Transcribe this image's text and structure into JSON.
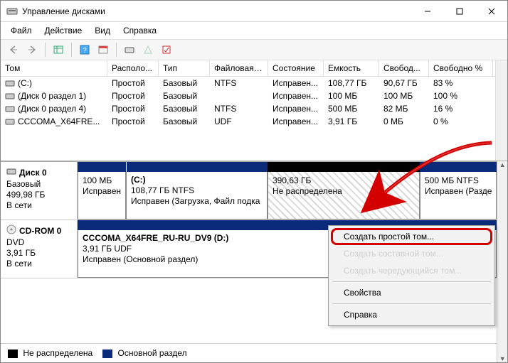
{
  "window": {
    "title": "Управление дисками"
  },
  "menu": {
    "file": "Файл",
    "action": "Действие",
    "view": "Вид",
    "help": "Справка"
  },
  "columns": {
    "volume": "Том",
    "layout": "Располо...",
    "type": "Тип",
    "fs": "Файловая с...",
    "status": "Состояние",
    "capacity": "Емкость",
    "free": "Свобод...",
    "free_pct": "Свободно %"
  },
  "volumes": [
    {
      "name": "(C:)",
      "layout": "Простой",
      "type": "Базовый",
      "fs": "NTFS",
      "status": "Исправен...",
      "capacity": "108,77 ГБ",
      "free": "90,67 ГБ",
      "free_pct": "83 %"
    },
    {
      "name": "(Диск 0 раздел 1)",
      "layout": "Простой",
      "type": "Базовый",
      "fs": "",
      "status": "Исправен...",
      "capacity": "100 МБ",
      "free": "100 МБ",
      "free_pct": "100 %"
    },
    {
      "name": "(Диск 0 раздел 4)",
      "layout": "Простой",
      "type": "Базовый",
      "fs": "NTFS",
      "status": "Исправен...",
      "capacity": "500 МБ",
      "free": "82 МБ",
      "free_pct": "16 %"
    },
    {
      "name": "CCCOMA_X64FRE...",
      "layout": "Простой",
      "type": "Базовый",
      "fs": "UDF",
      "status": "Исправен...",
      "capacity": "3,91 ГБ",
      "free": "0 МБ",
      "free_pct": "0 %"
    }
  ],
  "disk0": {
    "title": "Диск 0",
    "type": "Базовый",
    "size": "499,98 ГБ",
    "state": "В сети",
    "part0": {
      "title": "",
      "size": "100 МБ",
      "status": "Исправен"
    },
    "part1": {
      "title": "(C:)",
      "size": "108,77 ГБ NTFS",
      "status": "Исправен (Загрузка, Файл подка"
    },
    "part2": {
      "title": "",
      "size": "390,63 ГБ",
      "status": "Не распределена"
    },
    "part3": {
      "title": "",
      "size": "500 МБ NTFS",
      "status": "Исправен (Разде"
    }
  },
  "cdrom": {
    "title": "CD-ROM 0",
    "type": "DVD",
    "size": "3,91 ГБ",
    "state": "В сети",
    "vol_title": "CCCOMA_X64FRE_RU-RU_DV9  (D:)",
    "vol_size": "3,91 ГБ UDF",
    "vol_status": "Исправен (Основной раздел)"
  },
  "legend": {
    "unallocated": "Не распределена",
    "primary": "Основной раздел"
  },
  "ctx": {
    "simple": "Создать простой том...",
    "spanned": "Создать составной том...",
    "striped": "Создать чередующийся том...",
    "props": "Свойства",
    "help": "Справка"
  }
}
